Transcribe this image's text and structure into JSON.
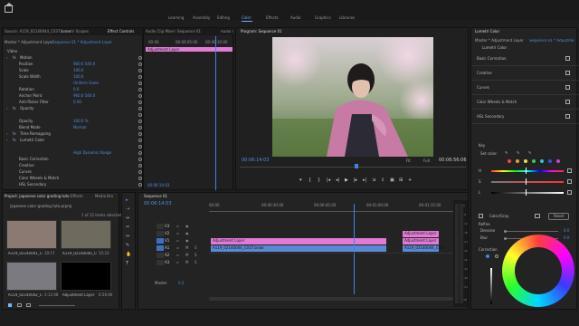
{
  "workspaces": [
    "Learning",
    "Assembly",
    "Editing",
    "Color",
    "Effects",
    "Audio",
    "Graphics",
    "Libraries"
  ],
  "active_workspace": "Color",
  "top_tabs": {
    "source": "Source: A119_02140044_C037.braw",
    "scopes": "Lumetri Scopes",
    "effect_controls": "Effect Controls",
    "audio_mixer": "Audio Clip Mixer: Sequence 01",
    "audio_track": "Audio Track Mixe"
  },
  "effect_controls": {
    "master_label": "Master * Adjustment Layer",
    "seq_label": "Sequence 01 * Adjustment Layer",
    "timecodes": [
      "00:00",
      "00:00:05:00",
      "00:00:10:00"
    ],
    "clip_label": "Adjustment Layer",
    "section": "Video",
    "rows": [
      {
        "name": "Motion",
        "value": "",
        "indent": 0
      },
      {
        "name": "Position",
        "value": "960.0    540.0",
        "indent": 1
      },
      {
        "name": "Scale",
        "value": "100.0",
        "indent": 1
      },
      {
        "name": "Scale Width",
        "value": "100.0",
        "indent": 1
      },
      {
        "name": "",
        "value": "Uniform Scale",
        "indent": 1
      },
      {
        "name": "Rotation",
        "value": "0.0",
        "indent": 1
      },
      {
        "name": "Anchor Point",
        "value": "960.0    540.0",
        "indent": 1
      },
      {
        "name": "Anti-flicker Filter",
        "value": "0.00",
        "indent": 1
      },
      {
        "name": "Opacity",
        "value": "",
        "indent": 0
      },
      {
        "name": "",
        "value": "",
        "indent": 1
      },
      {
        "name": "Opacity",
        "value": "100.0 %",
        "indent": 1
      },
      {
        "name": "Blend Mode",
        "value": "Normal",
        "indent": 1
      },
      {
        "name": "Time Remapping",
        "value": "",
        "indent": 0
      },
      {
        "name": "Lumetri Color",
        "value": "",
        "indent": 0
      },
      {
        "name": "",
        "value": "",
        "indent": 1
      },
      {
        "name": "",
        "value": "High Dynamic Range",
        "indent": 1
      },
      {
        "name": "Basic Correction",
        "value": "",
        "indent": 1
      },
      {
        "name": "Creative",
        "value": "",
        "indent": 1
      },
      {
        "name": "Curves",
        "value": "",
        "indent": 1
      },
      {
        "name": "Color Wheels & Match",
        "value": "",
        "indent": 1
      },
      {
        "name": "HSL Secondary",
        "value": "",
        "indent": 1
      }
    ],
    "bottom_timecode": "00:06:14:03"
  },
  "program": {
    "title": "Program: Sequence 01",
    "timecode": "00:06:14:03",
    "fit": "Fit",
    "quality": "Full",
    "duration": "00:06:56:06",
    "controls": [
      "marker-icon",
      "in-point-icon",
      "out-point-icon",
      "go-to-in-icon",
      "step-back-icon",
      "play-icon",
      "step-forward-icon",
      "go-to-out-icon",
      "insert-icon",
      "overwrite-icon",
      "export-frame-icon",
      "compare-icon",
      "settings-icon"
    ]
  },
  "lumetri": {
    "title": "Lumetri Color",
    "master": "Master * Adjustment Layer",
    "seq": "Sequence 01 * Adjustment Layer",
    "fx": "Lumetri Color",
    "sections": [
      "Basic Correction",
      "Creative",
      "Curves",
      "Color Wheels & Match",
      "HSL Secondary"
    ],
    "key": "Key",
    "set_color": "Set color:",
    "hsl": [
      "H",
      "S",
      "L"
    ],
    "hsl_colors": [
      "#ff4040",
      "#ff9a2a",
      "#f2e13a",
      "#2ed14a",
      "#2ec4e0",
      "#3050f0",
      "#d040d0"
    ],
    "color_gray": "Color/Gray",
    "reset": "Reset",
    "refine": "Refine",
    "refine_items": [
      {
        "name": "Denoise",
        "value": "0.0"
      },
      {
        "name": "Blur",
        "value": "0.0"
      }
    ],
    "correction": "Correction"
  },
  "project": {
    "tabs": [
      "Project: japanese color grading tuto",
      "Effects",
      "Media Bro"
    ],
    "file": "japanese color grading tuto.prproj",
    "selection": "1 of 12 items selected",
    "items": [
      {
        "name": "A119_02140041_C034...",
        "duration": "10:17",
        "thumb": "#8a7a72"
      },
      {
        "name": "A119_02140040_C038...",
        "duration": "15:23",
        "thumb": "#6e6a5e"
      },
      {
        "name": "A119_02140042_C034...",
        "duration": "2:12:08",
        "thumb": "#7a7a80"
      },
      {
        "name": "Adjustment Layer",
        "duration": "6:56:06",
        "thumb": "#000000"
      }
    ]
  },
  "sequence": {
    "tab": "Sequence 01",
    "timecode": "00:06:14:03",
    "ruler": [
      "00:00",
      "00:00:30:00",
      "00:00:45:00",
      "00:01:00:00",
      "00:01:15:00"
    ],
    "tracks": [
      "V3",
      "V2",
      "V1",
      "A1",
      "A2",
      "A3"
    ],
    "master": "Master",
    "master_val": "0.0",
    "clips": [
      {
        "label": "Adjustment Layer",
        "track": "V2",
        "color": "#e27ad6"
      },
      {
        "label": "A119_02140044_C037.braw",
        "track": "V1",
        "color": "#5b8ad4"
      },
      {
        "label": "Adjustment Layer",
        "track": "V3",
        "color": "#e27ad6"
      },
      {
        "label": "Adjustment Layer",
        "track": "V2",
        "color": "#e27ad6"
      },
      {
        "label": "A119_02140044_C037",
        "track": "V1",
        "color": "#5b8ad4"
      }
    ],
    "meter_labels": [
      "0",
      "-6",
      "-12",
      "-18",
      "-24",
      "-30",
      "-36",
      "-42",
      "-48",
      "-54"
    ],
    "meter_db": "dB"
  }
}
